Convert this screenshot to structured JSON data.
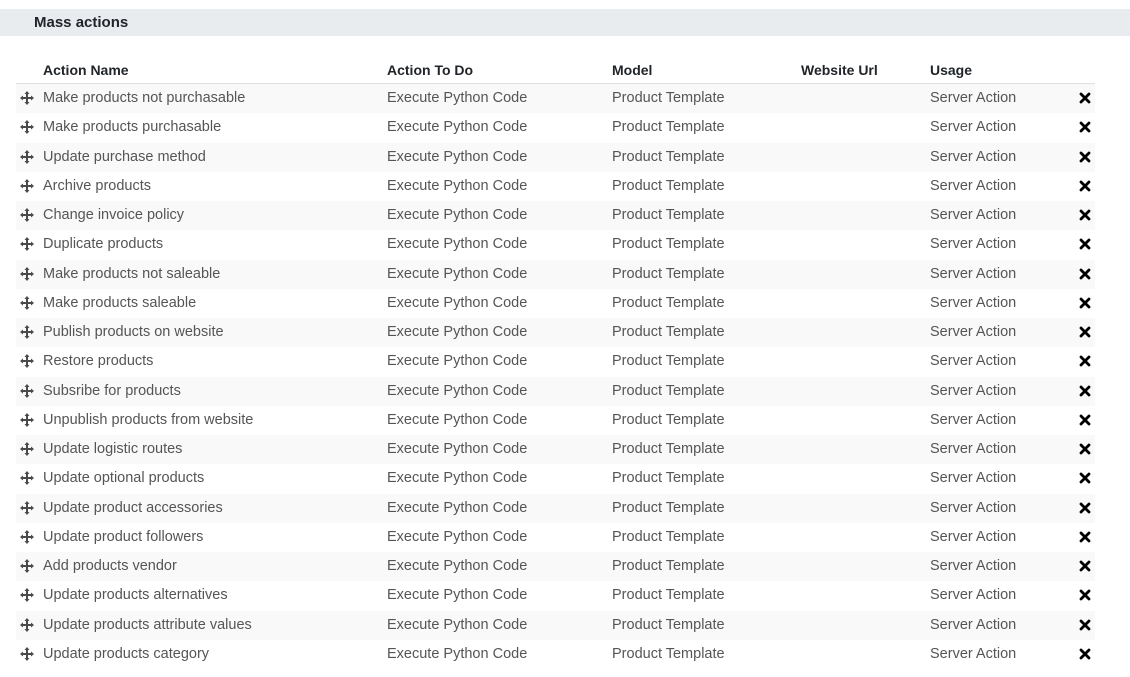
{
  "section": {
    "title": "Mass actions"
  },
  "columns": {
    "name": "Action Name",
    "todo": "Action To Do",
    "model": "Model",
    "url": "Website Url",
    "usage": "Usage"
  },
  "icons": {
    "handle": "drag-handle-icon",
    "delete": "delete-icon"
  },
  "rows": [
    {
      "name": "Make products not purchasable",
      "todo": "Execute Python Code",
      "model": "Product Template",
      "url": "",
      "usage": "Server Action"
    },
    {
      "name": "Make products purchasable",
      "todo": "Execute Python Code",
      "model": "Product Template",
      "url": "",
      "usage": "Server Action"
    },
    {
      "name": "Update purchase method",
      "todo": "Execute Python Code",
      "model": "Product Template",
      "url": "",
      "usage": "Server Action"
    },
    {
      "name": "Archive products",
      "todo": "Execute Python Code",
      "model": "Product Template",
      "url": "",
      "usage": "Server Action"
    },
    {
      "name": "Change invoice policy",
      "todo": "Execute Python Code",
      "model": "Product Template",
      "url": "",
      "usage": "Server Action"
    },
    {
      "name": "Duplicate products",
      "todo": "Execute Python Code",
      "model": "Product Template",
      "url": "",
      "usage": "Server Action"
    },
    {
      "name": "Make products not saleable",
      "todo": "Execute Python Code",
      "model": "Product Template",
      "url": "",
      "usage": "Server Action"
    },
    {
      "name": "Make products saleable",
      "todo": "Execute Python Code",
      "model": "Product Template",
      "url": "",
      "usage": "Server Action"
    },
    {
      "name": "Publish products on website",
      "todo": "Execute Python Code",
      "model": "Product Template",
      "url": "",
      "usage": "Server Action"
    },
    {
      "name": "Restore products",
      "todo": "Execute Python Code",
      "model": "Product Template",
      "url": "",
      "usage": "Server Action"
    },
    {
      "name": "Subsribe for products",
      "todo": "Execute Python Code",
      "model": "Product Template",
      "url": "",
      "usage": "Server Action"
    },
    {
      "name": "Unpublish products from website",
      "todo": "Execute Python Code",
      "model": "Product Template",
      "url": "",
      "usage": "Server Action"
    },
    {
      "name": "Update logistic routes",
      "todo": "Execute Python Code",
      "model": "Product Template",
      "url": "",
      "usage": "Server Action"
    },
    {
      "name": "Update optional products",
      "todo": "Execute Python Code",
      "model": "Product Template",
      "url": "",
      "usage": "Server Action"
    },
    {
      "name": "Update product accessories",
      "todo": "Execute Python Code",
      "model": "Product Template",
      "url": "",
      "usage": "Server Action"
    },
    {
      "name": "Update product followers",
      "todo": "Execute Python Code",
      "model": "Product Template",
      "url": "",
      "usage": "Server Action"
    },
    {
      "name": "Add products vendor",
      "todo": "Execute Python Code",
      "model": "Product Template",
      "url": "",
      "usage": "Server Action"
    },
    {
      "name": "Update products alternatives",
      "todo": "Execute Python Code",
      "model": "Product Template",
      "url": "",
      "usage": "Server Action"
    },
    {
      "name": "Update products attribute values",
      "todo": "Execute Python Code",
      "model": "Product Template",
      "url": "",
      "usage": "Server Action"
    },
    {
      "name": "Update products category",
      "todo": "Execute Python Code",
      "model": "Product Template",
      "url": "",
      "usage": "Server Action"
    }
  ]
}
